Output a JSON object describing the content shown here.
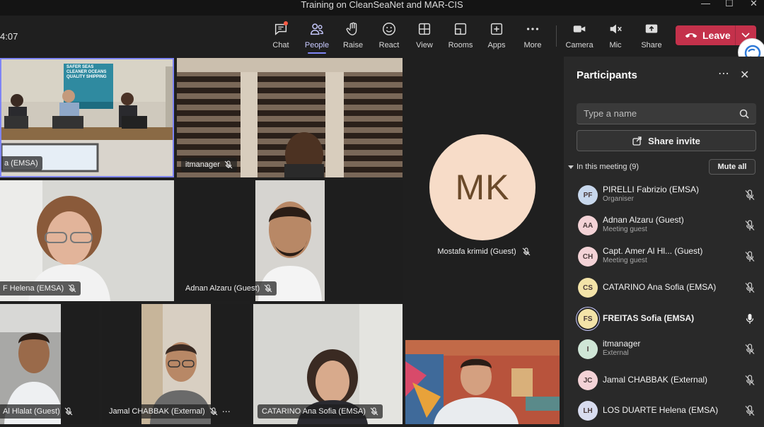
{
  "window": {
    "title": "Training on CleanSeaNet and MAR-CIS"
  },
  "call": {
    "timer": "4:07"
  },
  "toolbar": {
    "buttons": [
      {
        "id": "chat",
        "label": "Chat"
      },
      {
        "id": "people",
        "label": "People"
      },
      {
        "id": "raise",
        "label": "Raise"
      },
      {
        "id": "react",
        "label": "React"
      },
      {
        "id": "view",
        "label": "View"
      },
      {
        "id": "rooms",
        "label": "Rooms"
      },
      {
        "id": "apps",
        "label": "Apps"
      },
      {
        "id": "more",
        "label": "More"
      },
      {
        "id": "camera",
        "label": "Camera"
      },
      {
        "id": "mic",
        "label": "Mic"
      },
      {
        "id": "share",
        "label": "Share"
      }
    ],
    "active": "people",
    "leave_label": "Leave"
  },
  "tiles": {
    "t1_name": "a (EMSA)",
    "t1_banner": "SAFER SEAS CLEANER OCEANS QUALITY SHIPPING",
    "t2_name": "itmanager",
    "t3_name": "F Helena (EMSA)",
    "t4_name": "Adnan Alzaru (Guest)",
    "t5_initials": "MK",
    "t5_name": "Mostafa krimid (Guest)",
    "t6_name": "Al Hlalat (Guest)",
    "t7_name": "Jamal CHABBAK (External)",
    "t8_name": "CATARINO Ana Sofia (EMSA)"
  },
  "panel": {
    "title": "Participants",
    "search_placeholder": "Type a name",
    "share_invite": "Share invite",
    "in_meeting": "In this meeting (9)",
    "mute_all": "Mute all",
    "participants": [
      {
        "initials": "PF",
        "name": "PIRELLI Fabrizio (EMSA)",
        "role": "Organiser",
        "color": "#c7d7ec",
        "mic": "muted"
      },
      {
        "initials": "AA",
        "name": "Adnan Alzaru (Guest)",
        "role": "Meeting guest",
        "color": "#f3d2d6",
        "mic": "muted"
      },
      {
        "initials": "CH",
        "name": "Capt. Amer Al Hl... (Guest)",
        "role": "Meeting guest",
        "color": "#f3d2d6",
        "mic": "muted"
      },
      {
        "initials": "CS",
        "name": "CATARINO Ana Sofia (EMSA)",
        "role": "",
        "color": "#f3e3a8",
        "mic": "muted"
      },
      {
        "initials": "FS",
        "name": "FREITAS Sofia (EMSA)",
        "role": "",
        "color": "#f3e3a8",
        "mic": "on"
      },
      {
        "initials": "I",
        "name": "itmanager",
        "role": "External",
        "color": "#cfe6d6",
        "mic": "muted"
      },
      {
        "initials": "JC",
        "name": "Jamal CHABBAK (External)",
        "role": "",
        "color": "#f3d2d6",
        "mic": "muted"
      },
      {
        "initials": "LH",
        "name": "LOS DUARTE Helena (EMSA)",
        "role": "",
        "color": "#d8dcef",
        "mic": "muted"
      }
    ]
  }
}
